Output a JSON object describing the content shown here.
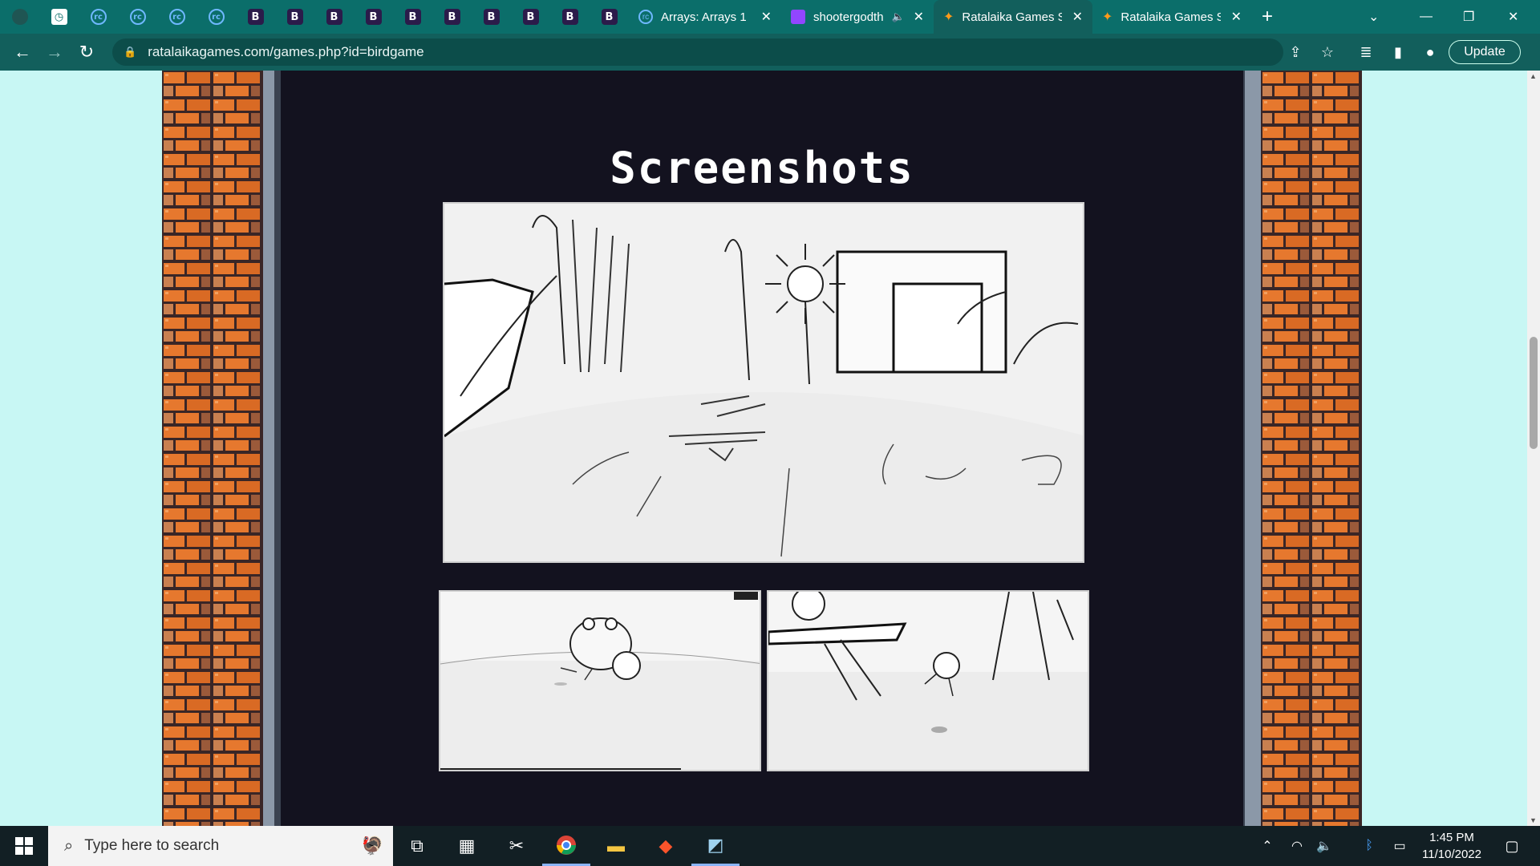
{
  "browser": {
    "tabs": [
      {
        "icon": "dark-app-icon",
        "label": ""
      },
      {
        "icon": "white-square-icon",
        "label": ""
      },
      {
        "icon": "rc-icon",
        "label": ""
      },
      {
        "icon": "rc-icon",
        "label": ""
      },
      {
        "icon": "rc-icon",
        "label": ""
      },
      {
        "icon": "rc-icon",
        "label": ""
      },
      {
        "icon": "b-icon",
        "label": ""
      },
      {
        "icon": "b-icon",
        "label": ""
      },
      {
        "icon": "b-icon",
        "label": ""
      },
      {
        "icon": "b-icon",
        "label": ""
      },
      {
        "icon": "b-icon",
        "label": ""
      },
      {
        "icon": "b-icon",
        "label": ""
      },
      {
        "icon": "b-icon",
        "label": ""
      },
      {
        "icon": "b-icon",
        "label": ""
      },
      {
        "icon": "b-icon",
        "label": ""
      },
      {
        "icon": "b-icon",
        "label": ""
      }
    ],
    "wide_tabs": [
      {
        "label": "Arrays: Arrays 1",
        "icon": "rc-icon"
      },
      {
        "label": "shootergodth",
        "icon": "twitch-icon"
      },
      {
        "label": "Ratalaika Games S",
        "icon": "bird-icon"
      },
      {
        "label": "Ratalaika Games S",
        "icon": "bird-icon"
      }
    ],
    "b_letter": "B",
    "rc_letter": "rc",
    "url": "ratalaikagames.com/games.php?id=birdgame",
    "update_label": "Update"
  },
  "page": {
    "section_title": "Screenshots"
  },
  "taskbar": {
    "search_placeholder": "Type here to search",
    "time": "1:45 PM",
    "date": "11/10/2022"
  },
  "colors": {
    "tab_bar": "#0b6e6a",
    "content_bg": "#13121f",
    "page_bg": "#c8f7f4",
    "brick": "#e6782e"
  }
}
